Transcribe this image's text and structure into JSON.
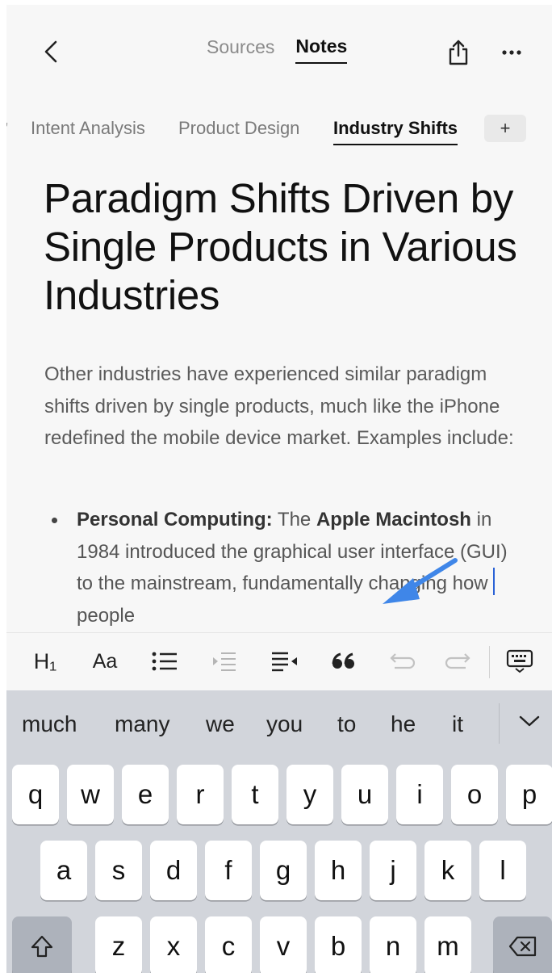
{
  "topbar": {
    "back_icon": "chevron-left-icon",
    "segments": [
      {
        "label": "Sources",
        "active": false
      },
      {
        "label": "Notes",
        "active": true
      }
    ],
    "share_icon": "share-icon",
    "more_icon": "more-horizontal-icon"
  },
  "tabs": {
    "items": [
      {
        "label": "Intent Analysis",
        "active": false
      },
      {
        "label": "Product Design",
        "active": false
      },
      {
        "label": "Industry Shifts",
        "active": true
      }
    ],
    "add_label": "+"
  },
  "document": {
    "title": "Paradigm Shifts Driven by Single Products in Various Industries",
    "paragraph": "Other industries have experienced similar paradigm shifts driven by single products, much like the iPhone redefined the mobile device market. Examples include:",
    "bullet": {
      "label": "Personal Computing:",
      "text_1": " The ",
      "product": "Apple Macintosh",
      "text_2": " in 1984 introduced the graphical user interface (GUI) to the mainstream, fundamentally changing how ",
      "text_3": "people"
    }
  },
  "format_toolbar": {
    "heading_label": "H₁",
    "font_label": "Aa",
    "icons": [
      "heading-icon",
      "font-style-icon",
      "bullet-list-icon",
      "indent-icon",
      "outdent-icon",
      "quote-icon",
      "undo-icon",
      "redo-icon",
      "keyboard-dismiss-icon"
    ]
  },
  "keyboard": {
    "suggestions": [
      "much",
      "many",
      "we",
      "you",
      "to",
      "he",
      "it"
    ],
    "row1": [
      "q",
      "w",
      "e",
      "r",
      "t",
      "y",
      "u",
      "i",
      "o",
      "p"
    ],
    "row2": [
      "a",
      "s",
      "d",
      "f",
      "g",
      "h",
      "j",
      "k",
      "l"
    ],
    "row3": [
      "z",
      "x",
      "c",
      "v",
      "b",
      "n",
      "m"
    ],
    "shift_icon": "shift-icon",
    "delete_icon": "backspace-icon"
  },
  "colors": {
    "cursor": "#2a62d6",
    "annotation_arrow": "#3f86e8"
  }
}
